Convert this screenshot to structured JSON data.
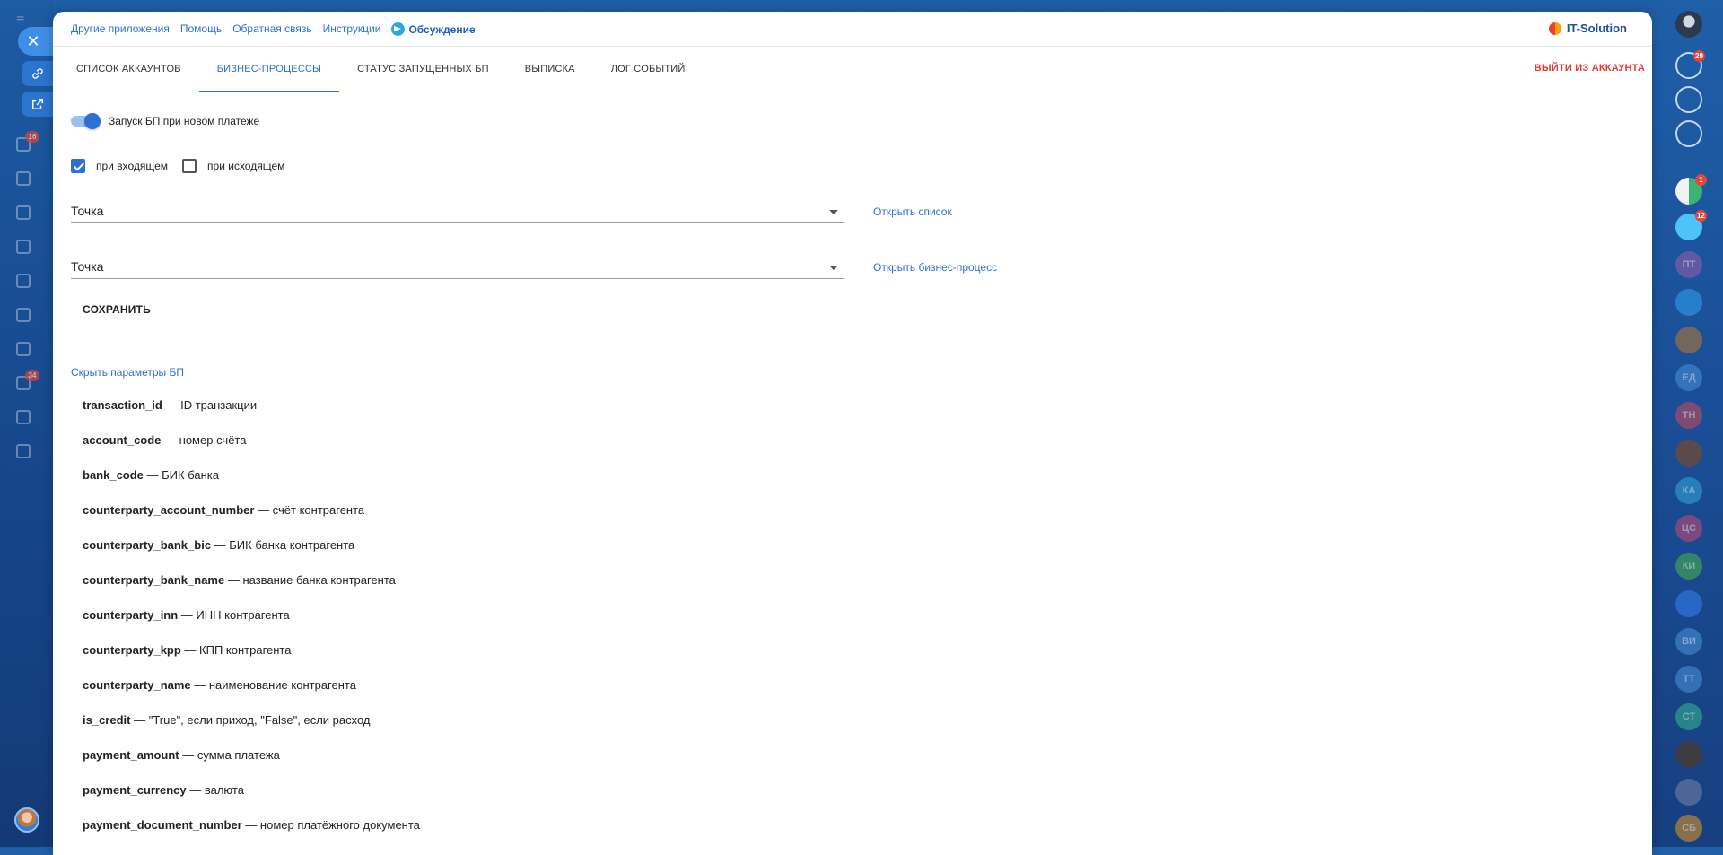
{
  "topbar": {
    "links": [
      "Другие приложения",
      "Помощь",
      "Обратная связь",
      "Инструкции"
    ],
    "discussion": "Обсуждение",
    "brand": "IT-Solution"
  },
  "tabs": [
    "СПИСОК АККАУНТОВ",
    "БИЗНЕС-ПРОЦЕССЫ",
    "СТАТУС ЗАПУЩЕННЫХ БП",
    "ВЫПИСКА",
    "ЛОГ СОБЫТИЙ"
  ],
  "active_tab": "БИЗНЕС-ПРОЦЕССЫ",
  "logout_label": "ВЫЙТИ ИЗ АККАУНТА",
  "form": {
    "toggle_label": "Запуск БП при новом платеже",
    "toggle_on": true,
    "incoming_label": "при входящем",
    "incoming_checked": true,
    "outgoing_label": "при исходящем",
    "outgoing_checked": false,
    "select1_value": "Точка",
    "select1_link": "Открыть список",
    "select2_value": "Точка",
    "select2_link": "Открыть бизнес-процесс",
    "save_label": "СОХРАНИТЬ",
    "hide_params_label": "Скрыть параметры БП"
  },
  "params": [
    {
      "name": "transaction_id",
      "desc": " — ID транзакции"
    },
    {
      "name": "account_code",
      "desc": " — номер счёта"
    },
    {
      "name": "bank_code",
      "desc": " — БИК банка"
    },
    {
      "name": "counterparty_account_number",
      "desc": " — счёт контрагента"
    },
    {
      "name": "counterparty_bank_bic",
      "desc": " — БИК банка контрагента"
    },
    {
      "name": "counterparty_bank_name",
      "desc": " — название банка контрагента"
    },
    {
      "name": "counterparty_inn",
      "desc": " — ИНН контрагента"
    },
    {
      "name": "counterparty_kpp",
      "desc": " — КПП контрагента"
    },
    {
      "name": "counterparty_name",
      "desc": " — наименование контрагента"
    },
    {
      "name": "is_credit",
      "desc": " — \"True\", если приход, \"False\", если расход"
    },
    {
      "name": "payment_amount",
      "desc": " — сумма платежа"
    },
    {
      "name": "payment_currency",
      "desc": " — валюта"
    },
    {
      "name": "payment_document_number",
      "desc": " — номер платёжного документа"
    }
  ],
  "background": {
    "left_badges": [
      "16",
      "34"
    ],
    "right_bar": [
      {
        "type": "avatar-photo",
        "badge": ""
      },
      {
        "type": "bell-icon",
        "badge": "29"
      },
      {
        "type": "spiral-icon",
        "badge": ""
      },
      {
        "type": "chat-icon",
        "badge": ""
      },
      {
        "type": "app-avatar",
        "badge": "1"
      },
      {
        "type": "chat-avatar",
        "badge": "12"
      },
      {
        "type": "initials",
        "text": "ПТ",
        "color": "#7b5aa6"
      },
      {
        "type": "support-icon",
        "color": "#2a8bd8"
      },
      {
        "type": "photo",
        "color": "#8a6b4e"
      },
      {
        "type": "initials",
        "text": "ЕД",
        "color": "#3e7fc4"
      },
      {
        "type": "initials",
        "text": "ТН",
        "color": "#a04a6a"
      },
      {
        "type": "photo",
        "color": "#6b4a3a"
      },
      {
        "type": "initials",
        "text": "КА",
        "color": "#2c8fc9"
      },
      {
        "type": "initials",
        "text": "ЦС",
        "color": "#9b4a7a"
      },
      {
        "type": "initials",
        "text": "КИ",
        "color": "#3c9a5a"
      },
      {
        "type": "bookmark-icon",
        "color": "#2d6fd3"
      },
      {
        "type": "initials",
        "text": "ВИ",
        "color": "#3e7fc4"
      },
      {
        "type": "initials",
        "text": "ТТ",
        "color": "#3e7fc4"
      },
      {
        "type": "initials",
        "text": "СТ",
        "color": "#2c9a8c"
      },
      {
        "type": "photo",
        "color": "#4a3a32"
      },
      {
        "type": "photo",
        "color": "#5a6fa0"
      },
      {
        "type": "initials",
        "text": "СБ",
        "color": "#b0813a"
      }
    ]
  }
}
